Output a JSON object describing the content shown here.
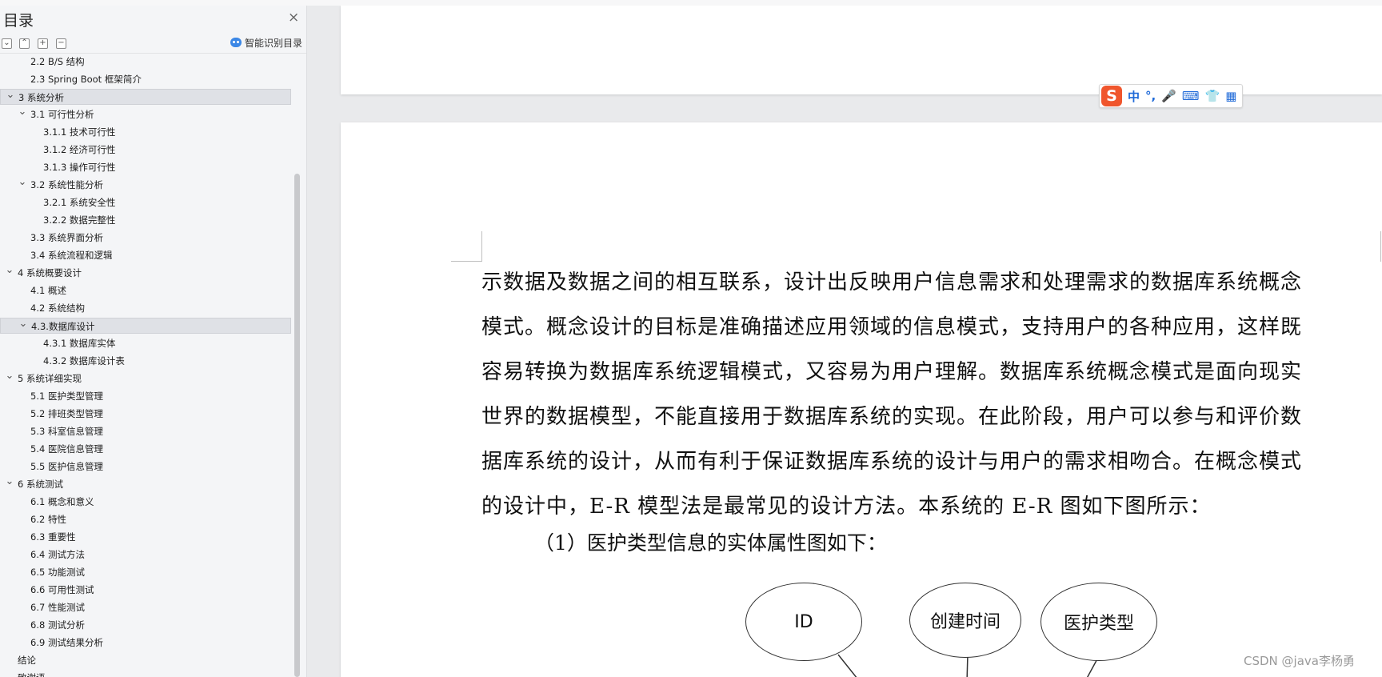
{
  "sidebar": {
    "title": "目录",
    "close_glyph": "×",
    "toolbar": {
      "collapse_all_glyph": "⌄",
      "expand_up_glyph": "⌃",
      "add_glyph": "+",
      "remove_glyph": "−",
      "ai_label": "智能识别目录"
    },
    "toc": [
      {
        "label": "2.2 B/S 结构"
      },
      {
        "label": "2.3 Spring Boot 框架简介"
      },
      {
        "label": "3 系统分析",
        "chev": "v",
        "selected": true
      },
      {
        "label": "3.1 可行性分析",
        "chev": "v"
      },
      {
        "label": "3.1.1 技术可行性"
      },
      {
        "label": "3.1.2 经济可行性"
      },
      {
        "label": "3.1.3 操作可行性"
      },
      {
        "label": "3.2 系统性能分析",
        "chev": "v"
      },
      {
        "label": "3.2.1  系统安全性"
      },
      {
        "label": "3.2.2  数据完整性"
      },
      {
        "label": "3.3 系统界面分析"
      },
      {
        "label": "3.4 系统流程和逻辑"
      },
      {
        "label": "4 系统概要设计",
        "chev": "v"
      },
      {
        "label": "4.1 概述"
      },
      {
        "label": "4.2 系统结构"
      },
      {
        "label": "4.3.数据库设计",
        "chev": "v",
        "selected": true
      },
      {
        "label": "4.3.1 数据库实体"
      },
      {
        "label": "4.3.2 数据库设计表"
      },
      {
        "label": "5 系统详细实现",
        "chev": "v"
      },
      {
        "label": "5.1  医护类型管理"
      },
      {
        "label": "5.2  排班类型管理"
      },
      {
        "label": "5.3  科室信息管理"
      },
      {
        "label": "5.4  医院信息管理"
      },
      {
        "label": "5.5  医护信息管理"
      },
      {
        "label": "6 系统测试",
        "chev": "v"
      },
      {
        "label": "6.1 概念和意义"
      },
      {
        "label": "6.2 特性"
      },
      {
        "label": "6.3 重要性"
      },
      {
        "label": "6.4 测试方法"
      },
      {
        "label": "6.5  功能测试"
      },
      {
        "label": "6.6 可用性测试"
      },
      {
        "label": "6.7 性能测试"
      },
      {
        "label": "6.8 测试分析"
      },
      {
        "label": "6.9 测试结果分析"
      },
      {
        "label": "结论"
      },
      {
        "label": "致谢语"
      }
    ]
  },
  "ime": {
    "logo": "S",
    "items": [
      "中",
      "°,",
      "🎤",
      "⌨",
      "👕",
      "▦"
    ]
  },
  "document": {
    "paragraph_lines": [
      "示数据及数据之间的相互联系，设计出反映用户信息需求和处理需求的数据库系统概念",
      "模式。概念设计的目标是准确描述应用领域的信息模式，支持用户的各种应用，这样既",
      "容易转换为数据库系统逻辑模式，又容易为用户理解。数据库系统概念模式是面向现实",
      "世界的数据模型，不能直接用于数据库系统的实现。在此阶段，用户可以参与和评价数",
      "据库系统的设计，从而有利于保证数据库系统的设计与用户的需求相吻合。在概念模式",
      "的设计中，E-R 模型法是最常见的设计方法。本系统的 E-R 图如下图所示："
    ],
    "subheading": "（1）医护类型信息的实体属性图如下：",
    "er_attributes": [
      "ID",
      "创建时间",
      "医护类型"
    ]
  },
  "watermark": "CSDN @java李杨勇"
}
